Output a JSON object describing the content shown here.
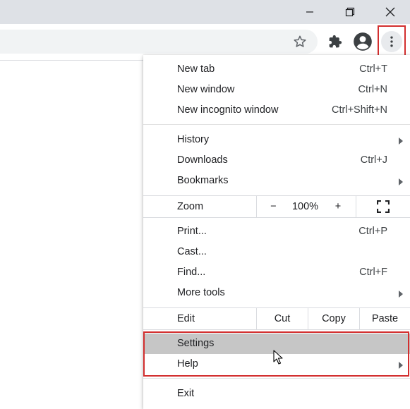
{
  "menu": {
    "group1": [
      {
        "label": "New tab",
        "shortcut": "Ctrl+T"
      },
      {
        "label": "New window",
        "shortcut": "Ctrl+N"
      },
      {
        "label": "New incognito window",
        "shortcut": "Ctrl+Shift+N"
      }
    ],
    "group2": [
      {
        "label": "History",
        "shortcut": ""
      },
      {
        "label": "Downloads",
        "shortcut": "Ctrl+J"
      },
      {
        "label": "Bookmarks",
        "shortcut": ""
      }
    ],
    "zoom": {
      "label": "Zoom",
      "minus": "−",
      "value": "100%",
      "plus": "+"
    },
    "group3": [
      {
        "label": "Print...",
        "shortcut": "Ctrl+P"
      },
      {
        "label": "Cast...",
        "shortcut": ""
      },
      {
        "label": "Find...",
        "shortcut": "Ctrl+F"
      },
      {
        "label": "More tools",
        "shortcut": ""
      }
    ],
    "edit": {
      "label": "Edit",
      "cut": "Cut",
      "copy": "Copy",
      "paste": "Paste"
    },
    "group4": [
      {
        "label": "Settings"
      },
      {
        "label": "Help"
      }
    ],
    "exit": {
      "label": "Exit"
    }
  },
  "colors": {
    "highlight_border": "#d32f2f",
    "hovered_item": "#c6c6c6"
  }
}
